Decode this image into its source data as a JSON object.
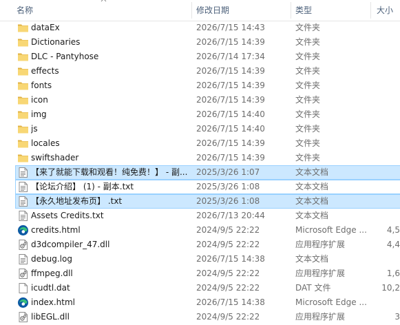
{
  "columns": {
    "name": "名称",
    "date": "修改日期",
    "type": "类型",
    "size": "大小"
  },
  "colors": {
    "folder": "#f8d775",
    "folder_dark": "#e0b244",
    "selection": "#cce8ff",
    "selection_border": "#99d1ff",
    "edge_blue": "#0c59a4",
    "edge_green": "#37c17d"
  },
  "files": [
    {
      "icon": "folder-icon",
      "name": "dataEx",
      "date": "2026/7/15 14:43",
      "type": "文件夹",
      "size": ""
    },
    {
      "icon": "folder-icon",
      "name": "Dictionaries",
      "date": "2026/7/15 14:39",
      "type": "文件夹",
      "size": ""
    },
    {
      "icon": "folder-icon",
      "name": "DLC - Pantyhose",
      "date": "2026/7/14 17:34",
      "type": "文件夹",
      "size": ""
    },
    {
      "icon": "folder-icon",
      "name": "effects",
      "date": "2026/7/15 14:39",
      "type": "文件夹",
      "size": ""
    },
    {
      "icon": "folder-icon",
      "name": "fonts",
      "date": "2026/7/15 14:39",
      "type": "文件夹",
      "size": ""
    },
    {
      "icon": "folder-icon",
      "name": "icon",
      "date": "2026/7/15 14:39",
      "type": "文件夹",
      "size": ""
    },
    {
      "icon": "folder-icon",
      "name": "img",
      "date": "2026/7/15 14:40",
      "type": "文件夹",
      "size": ""
    },
    {
      "icon": "folder-icon",
      "name": "js",
      "date": "2026/7/15 14:40",
      "type": "文件夹",
      "size": ""
    },
    {
      "icon": "folder-icon",
      "name": "locales",
      "date": "2026/7/15 14:39",
      "type": "文件夹",
      "size": ""
    },
    {
      "icon": "folder-icon",
      "name": "swiftshader",
      "date": "2026/7/15 14:39",
      "type": "文件夹",
      "size": ""
    },
    {
      "icon": "text-file-icon",
      "name": "【来了就能下载和观看！纯免费！】 - 副...",
      "date": "2025/3/26 1:07",
      "type": "文本文档",
      "size": "",
      "selected": true
    },
    {
      "icon": "text-file-icon",
      "name": "【论坛介绍】 (1) - 副本.txt",
      "date": "2025/3/26 1:08",
      "type": "文本文档",
      "size": "",
      "selected": true,
      "focused": true
    },
    {
      "icon": "text-file-icon",
      "name": "【永久地址发布页】 .txt",
      "date": "2025/3/26 1:08",
      "type": "文本文档",
      "size": "",
      "selected": true
    },
    {
      "icon": "text-file-icon",
      "name": "Assets Credits.txt",
      "date": "2026/7/13 20:44",
      "type": "文本文档",
      "size": ""
    },
    {
      "icon": "edge-icon",
      "name": "credits.html",
      "date": "2024/9/5 22:22",
      "type": "Microsoft Edge ...",
      "size": "4,5"
    },
    {
      "icon": "dll-icon",
      "name": "d3dcompiler_47.dll",
      "date": "2024/9/5 22:22",
      "type": "应用程序扩展",
      "size": "4,4"
    },
    {
      "icon": "text-file-icon",
      "name": "debug.log",
      "date": "2026/7/15 14:38",
      "type": "文本文档",
      "size": ""
    },
    {
      "icon": "dll-icon",
      "name": "ffmpeg.dll",
      "date": "2024/9/5 22:22",
      "type": "应用程序扩展",
      "size": "1,6"
    },
    {
      "icon": "blank-file-icon",
      "name": "icudtl.dat",
      "date": "2024/9/5 22:22",
      "type": "DAT 文件",
      "size": "10,2"
    },
    {
      "icon": "edge-icon",
      "name": "index.html",
      "date": "2026/7/15 14:38",
      "type": "Microsoft Edge ...",
      "size": ""
    },
    {
      "icon": "dll-icon",
      "name": "libEGL.dll",
      "date": "2024/9/5 22:22",
      "type": "应用程序扩展",
      "size": "3"
    }
  ]
}
